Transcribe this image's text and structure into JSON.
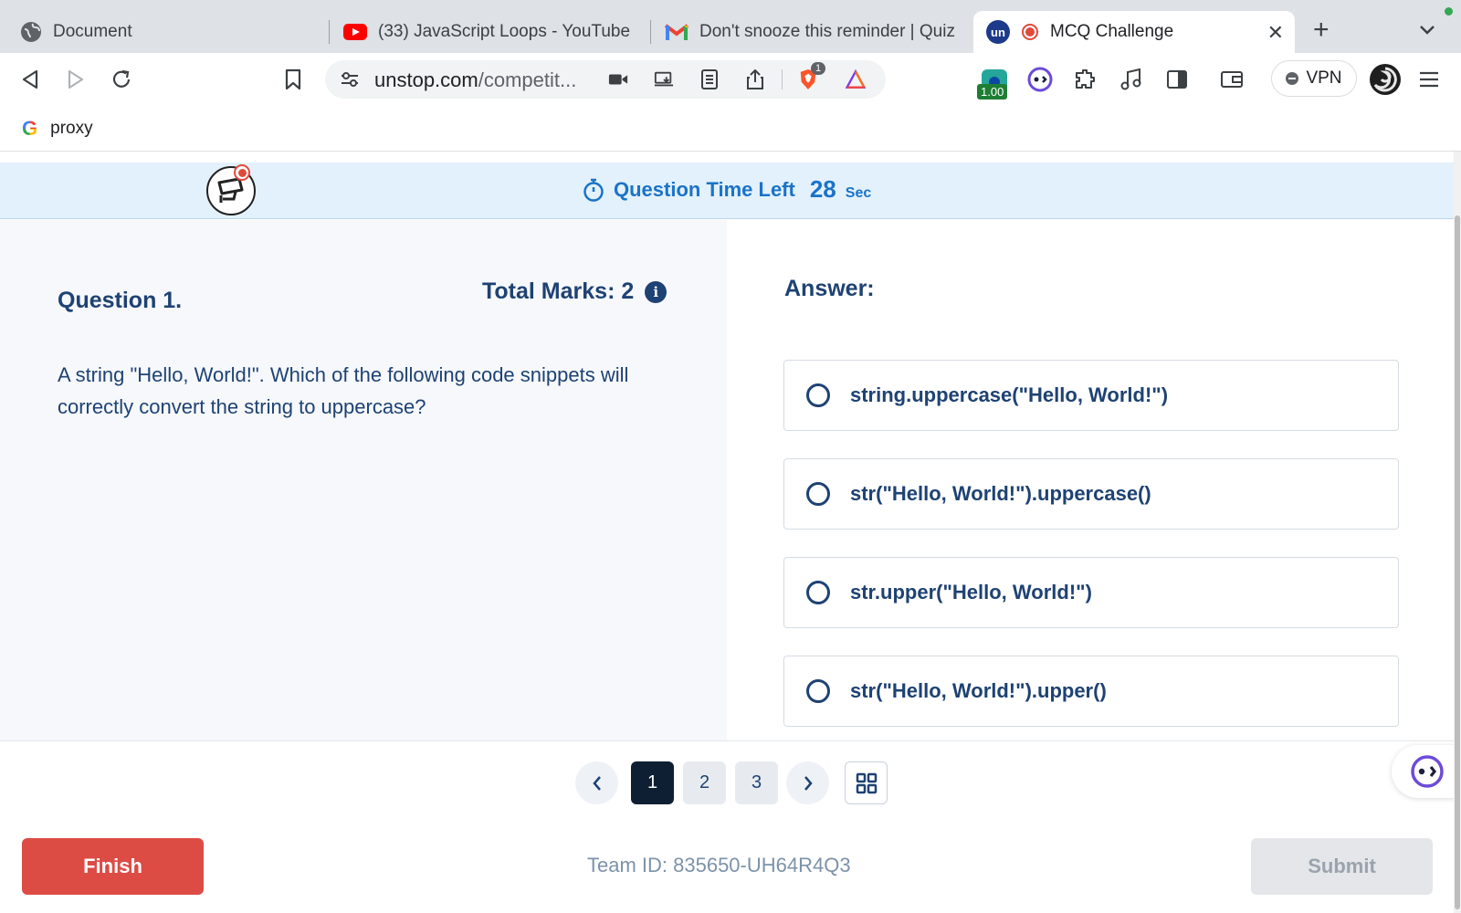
{
  "browser": {
    "tabs": [
      {
        "title": "Document",
        "icon": "globe-icon"
      },
      {
        "title": "(33) JavaScript Loops - YouTube",
        "icon": "youtube-icon"
      },
      {
        "title": "Don't snooze this reminder | Quiz",
        "icon": "gmail-icon"
      },
      {
        "title": "MCQ Challenge",
        "icon": "unstop-icon",
        "active": true
      }
    ],
    "url_host": "unstop.com",
    "url_path": "/competit...",
    "shields_count": "1",
    "ext_badge": "1.00",
    "vpn_label": "VPN",
    "bookmark": "proxy"
  },
  "quiz": {
    "timer_label": "Question Time Left",
    "timer_value": "28",
    "timer_unit": "Sec",
    "question_number": "Question 1.",
    "total_marks": "Total Marks: 2",
    "question_text": "A string \"Hello, World!\". Which of the following code snippets will correctly convert the string to uppercase?",
    "answer_label": "Answer:",
    "options": [
      "string.uppercase(\"Hello, World!\")",
      "str(\"Hello, World!\").uppercase()",
      "str.upper(\"Hello, World!\")",
      "str(\"Hello, World!\").upper()"
    ],
    "pages": [
      "1",
      "2",
      "3"
    ],
    "current_page": "1",
    "finish_label": "Finish",
    "team_id": "Team ID: 835650-UH64R4Q3",
    "submit_label": "Submit"
  },
  "colors": {
    "accent": "#1a73c8",
    "text": "#1e4273",
    "finish": "#dd4b45",
    "timer_bg": "#e3f1fc"
  }
}
